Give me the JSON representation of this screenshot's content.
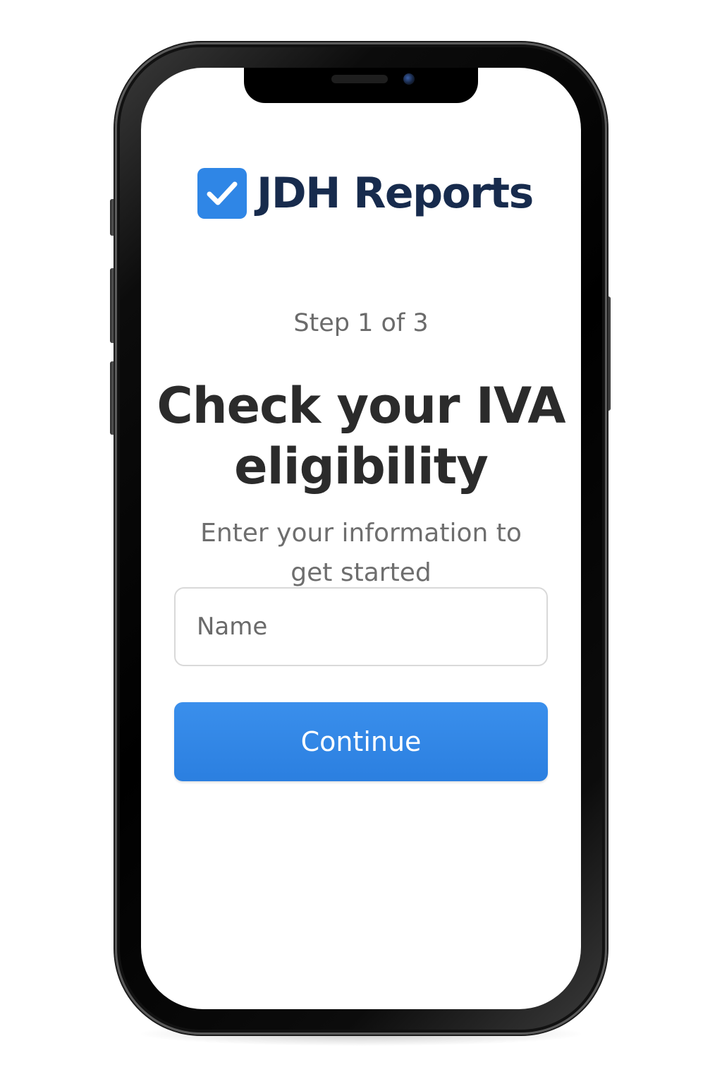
{
  "app": {
    "brand_name": "JDH Reports",
    "brand_icon": "check-icon",
    "accent_color": "#2F86E6",
    "brand_text_color": "#172B4D"
  },
  "onboarding": {
    "step_label": "Step 1 of 3",
    "headline": "Check your IVA eligibility",
    "subtitle": "Enter your information to get started",
    "name_field": {
      "placeholder": "Name",
      "value": ""
    },
    "continue_label": "Continue"
  }
}
